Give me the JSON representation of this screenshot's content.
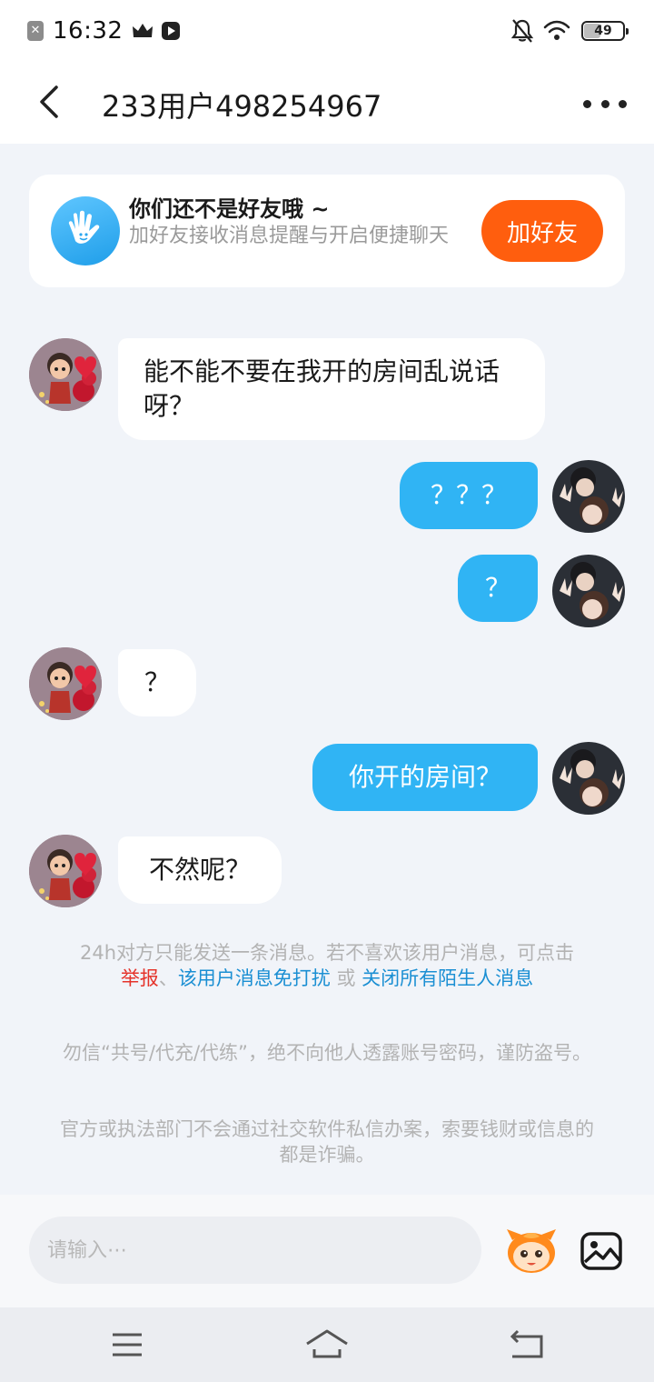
{
  "status_bar": {
    "time": "16:32",
    "battery": "49",
    "icons": [
      "close-badge-icon",
      "crown-icon",
      "play-icon",
      "bell-off-icon",
      "wifi-icon",
      "battery-icon"
    ]
  },
  "header": {
    "title": "233用户498254967",
    "icons": [
      "back-arrow-icon",
      "more-icon"
    ]
  },
  "friend_card": {
    "title": "你们还不是好友哦 ~",
    "description": "加好友接收消息提醒与开启便捷聊天",
    "button_label": "加好友",
    "icon": "hand-wave-icon"
  },
  "messages": [
    {
      "side": "in",
      "text": "能不能不要在我开的房间乱说话呀？"
    },
    {
      "side": "out",
      "text": "？？？"
    },
    {
      "side": "out",
      "text": "？"
    },
    {
      "side": "in",
      "text": "？"
    },
    {
      "side": "out",
      "text": "你开的房间？"
    },
    {
      "side": "in",
      "text": "不然呢？"
    }
  ],
  "notices": {
    "limit_prefix": "24h对方只能发送一条消息。若不喜欢该用户消息，可点击",
    "report_link": "举报",
    "separator": "、",
    "mute_link": "该用户消息免打扰",
    "or_text": " 或 ",
    "close_strangers_link": "关闭所有陌生人消息",
    "safety_1": "勿信“共号/代充/代练”，绝不向他人透露账号密码，谨防盗号。",
    "safety_2": "官方或执法部门不会通过社交软件私信办案，索要钱财或信息的都是诈骗。"
  },
  "input": {
    "placeholder": "请输入⋯",
    "icons": [
      "emoji-mascot-icon",
      "image-icon"
    ]
  },
  "nav_bar": {
    "icons": [
      "menu-icon",
      "home-icon",
      "back-icon"
    ]
  },
  "colors": {
    "accent_orange": "#ff5e0e",
    "outgoing_bubble": "#30b4f4",
    "link_blue": "#1b8fd3",
    "link_red": "#e5332a"
  }
}
